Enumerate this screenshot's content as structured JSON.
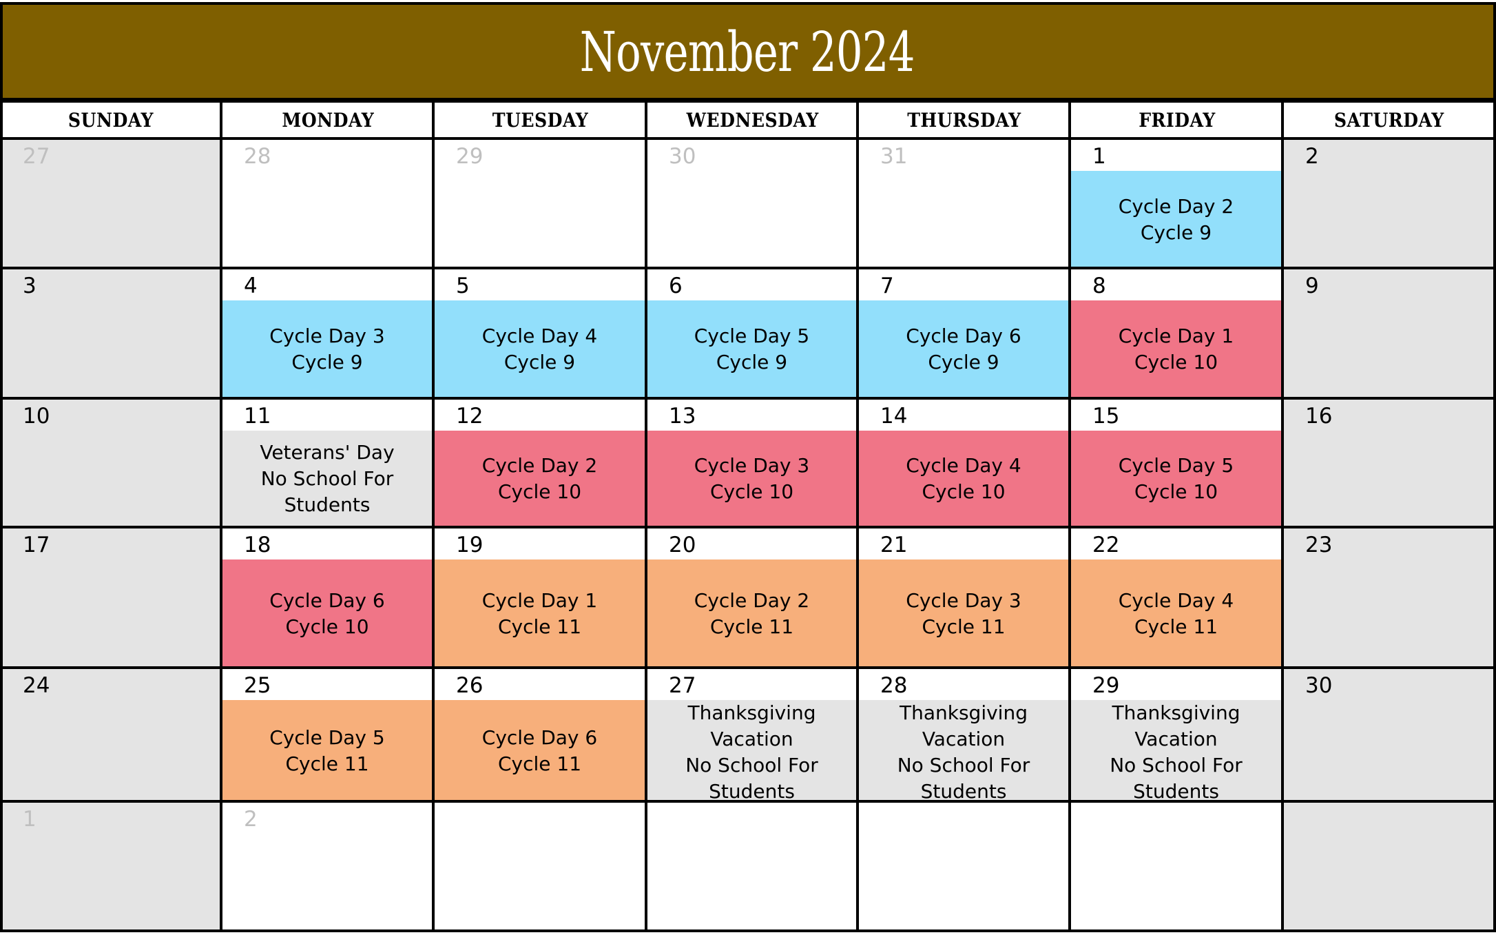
{
  "title": "November 2024",
  "colors": {
    "header_bg": "#7F5F00",
    "cycle9": "#92DFFB",
    "cycle10": "#F07587",
    "cycle11": "#F7AF7B",
    "no_school": "#E4E4E4",
    "weekend": "#E4E4E4",
    "muted_date": "#BFBFBF"
  },
  "weekdays": [
    "SUNDAY",
    "MONDAY",
    "TUESDAY",
    "WEDNESDAY",
    "THURSDAY",
    "FRIDAY",
    "SATURDAY"
  ],
  "weeks": [
    [
      {
        "day": "27",
        "muted": true
      },
      {
        "day": "28",
        "muted": true
      },
      {
        "day": "29",
        "muted": true
      },
      {
        "day": "30",
        "muted": true
      },
      {
        "day": "31",
        "muted": true
      },
      {
        "day": "1",
        "event": {
          "lines": [
            "Cycle Day 2",
            "Cycle 9"
          ],
          "color": "cycle9"
        }
      },
      {
        "day": "2"
      }
    ],
    [
      {
        "day": "3"
      },
      {
        "day": "4",
        "event": {
          "lines": [
            "Cycle Day 3",
            "Cycle 9"
          ],
          "color": "cycle9"
        }
      },
      {
        "day": "5",
        "event": {
          "lines": [
            "Cycle Day 4",
            "Cycle 9"
          ],
          "color": "cycle9"
        }
      },
      {
        "day": "6",
        "event": {
          "lines": [
            "Cycle Day 5",
            "Cycle 9"
          ],
          "color": "cycle9"
        }
      },
      {
        "day": "7",
        "event": {
          "lines": [
            "Cycle Day 6",
            "Cycle 9"
          ],
          "color": "cycle9"
        }
      },
      {
        "day": "8",
        "event": {
          "lines": [
            "Cycle Day 1",
            "Cycle 10"
          ],
          "color": "cycle10"
        }
      },
      {
        "day": "9"
      }
    ],
    [
      {
        "day": "10"
      },
      {
        "day": "11",
        "event": {
          "lines": [
            "Veterans' Day",
            "No School For",
            "Students"
          ],
          "color": "no_school"
        }
      },
      {
        "day": "12",
        "event": {
          "lines": [
            "Cycle Day 2",
            "Cycle 10"
          ],
          "color": "cycle10"
        }
      },
      {
        "day": "13",
        "event": {
          "lines": [
            "Cycle Day 3",
            "Cycle 10"
          ],
          "color": "cycle10"
        }
      },
      {
        "day": "14",
        "event": {
          "lines": [
            "Cycle Day 4",
            "Cycle 10"
          ],
          "color": "cycle10"
        }
      },
      {
        "day": "15",
        "event": {
          "lines": [
            "Cycle Day 5",
            "Cycle 10"
          ],
          "color": "cycle10"
        }
      },
      {
        "day": "16"
      }
    ],
    [
      {
        "day": "17"
      },
      {
        "day": "18",
        "event": {
          "lines": [
            "Cycle Day 6",
            "Cycle 10"
          ],
          "color": "cycle10"
        }
      },
      {
        "day": "19",
        "event": {
          "lines": [
            "Cycle Day 1",
            "Cycle 11"
          ],
          "color": "cycle11"
        }
      },
      {
        "day": "20",
        "event": {
          "lines": [
            "Cycle Day 2",
            "Cycle 11"
          ],
          "color": "cycle11"
        }
      },
      {
        "day": "21",
        "event": {
          "lines": [
            "Cycle Day 3",
            "Cycle 11"
          ],
          "color": "cycle11"
        }
      },
      {
        "day": "22",
        "event": {
          "lines": [
            "Cycle Day 4",
            "Cycle 11"
          ],
          "color": "cycle11"
        }
      },
      {
        "day": "23"
      }
    ],
    [
      {
        "day": "24"
      },
      {
        "day": "25",
        "event": {
          "lines": [
            "Cycle Day 5",
            "Cycle 11"
          ],
          "color": "cycle11"
        }
      },
      {
        "day": "26",
        "event": {
          "lines": [
            "Cycle Day 6",
            "Cycle 11"
          ],
          "color": "cycle11"
        }
      },
      {
        "day": "27",
        "event": {
          "lines": [
            "Thanksgiving",
            "Vacation",
            "No School For",
            "Students"
          ],
          "color": "no_school"
        }
      },
      {
        "day": "28",
        "event": {
          "lines": [
            "Thanksgiving",
            "Vacation",
            "No School For",
            "Students"
          ],
          "color": "no_school"
        }
      },
      {
        "day": "29",
        "event": {
          "lines": [
            "Thanksgiving",
            "Vacation",
            "No School For",
            "Students"
          ],
          "color": "no_school"
        }
      },
      {
        "day": "30"
      }
    ],
    [
      {
        "day": "1",
        "muted": true
      },
      {
        "day": "2",
        "muted": true
      },
      {
        "day": ""
      },
      {
        "day": ""
      },
      {
        "day": ""
      },
      {
        "day": ""
      },
      {
        "day": ""
      }
    ]
  ]
}
